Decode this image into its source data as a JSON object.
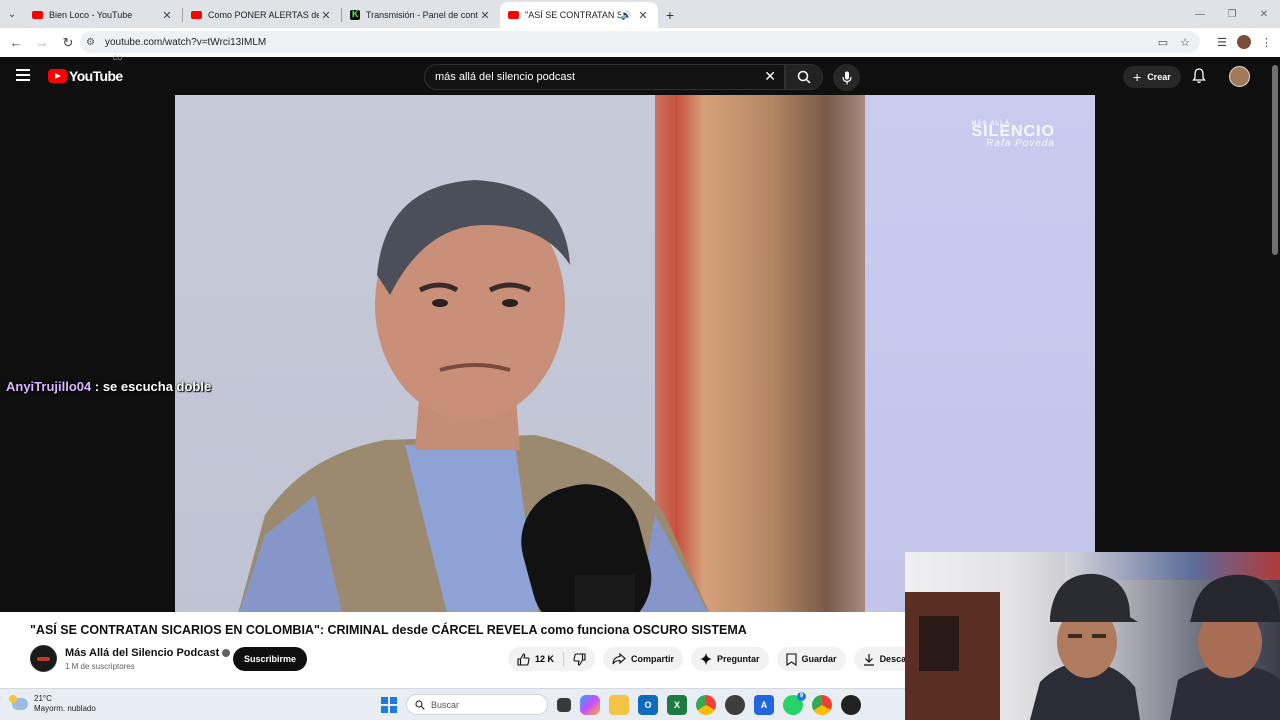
{
  "browser": {
    "tabs": [
      {
        "title": "Bien Loco - YouTube",
        "favicon": "youtube-icon",
        "active": false
      },
      {
        "title": "Como PONER ALERTAS de KICK",
        "favicon": "youtube-icon",
        "active": false
      },
      {
        "title": "Transmisión - Panel de control de",
        "favicon": "kick-icon",
        "active": false
      },
      {
        "title": "\"ASÍ SE CONTRATAN SICARI",
        "favicon": "youtube-icon",
        "active": true
      }
    ],
    "url": "youtube.com/watch?v=tWrci13IMLM"
  },
  "youtube": {
    "logo_text": "YouTube",
    "country_code": "CO",
    "search_value": "más allá del silencio podcast",
    "create_label": "Crear"
  },
  "video": {
    "watermark_top": "MÁS ALLÁ",
    "watermark_main": "SILENCIO",
    "watermark_sign": "Rafa Poveda",
    "chat_user": "AnyiTrujillo04",
    "chat_message": ": se escucha doble",
    "title": "\"ASÍ SE CONTRATAN SICARIOS EN COLOMBIA\": CRIMINAL desde CÁRCEL REVELA como funciona OSCURO SISTEMA",
    "channel_name": "Más Allá del Silencio Podcast",
    "subscribers": "1 M de suscriptores",
    "subscribe_label": "Suscribirme",
    "likes": "12 K",
    "share_label": "Compartir",
    "ask_label": "Preguntar",
    "save_label": "Guardar",
    "download_label": "Descar"
  },
  "taskbar": {
    "temperature": "21°C",
    "weather_desc": "Mayorm. nublado",
    "search_placeholder": "Buscar",
    "whatsapp_badge": "9"
  },
  "colors": {
    "youtube_red": "#ff0000",
    "page_bg": "#0f0f0f",
    "chat_user": "#d9b8ff"
  }
}
